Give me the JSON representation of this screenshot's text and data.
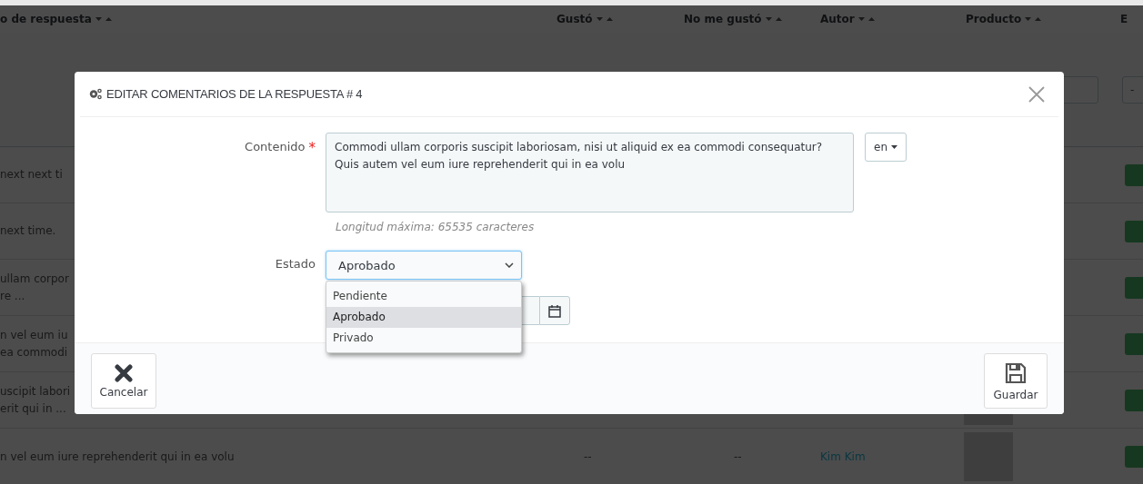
{
  "background_table": {
    "columns": [
      {
        "label": "o de respuesta",
        "sortable": true
      },
      {
        "label": "Gustó",
        "sortable": true
      },
      {
        "label": "No me gustó",
        "sortable": true
      },
      {
        "label": "Autor",
        "sortable": true
      },
      {
        "label": "Producto",
        "sortable": true
      },
      {
        "label": "E",
        "sortable": false
      }
    ],
    "filter_select": "-",
    "rows": [
      {
        "column_1": [
          "next next ti"
        ]
      },
      {
        "column_1": [
          "next time."
        ]
      },
      {
        "column_1": [
          "ullam corpor",
          "re ..."
        ]
      },
      {
        "column_1": [
          "n vel eum iu",
          "ea commodi"
        ]
      },
      {
        "column_1": [
          "uscipit labori",
          "erit qui in ..."
        ],
        "photo": true
      },
      {
        "column_1": [
          "n vel eum iure reprehenderit qui in ea volu"
        ],
        "liked": "--",
        "disliked": "--",
        "author": "Kim Kim",
        "photo": true
      }
    ]
  },
  "modal": {
    "title": "EDITAR COMENTARIOS DE LA RESPUESTA # 4",
    "content_field": {
      "label": "Contenido",
      "required_mark": "*",
      "value": "Commodi ullam corporis suscipit laboriosam, nisi ut aliquid ex ea commodi consequatur? Quis autem vel eum iure reprehenderit qui in ea volu",
      "language": "en",
      "help": "Longitud máxima: 65535 caracteres"
    },
    "status_field": {
      "label": "Estado",
      "value": "Aprobado",
      "expanded": true,
      "options": [
        {
          "label": "Pendiente",
          "selected": false
        },
        {
          "label": "Aprobado",
          "selected": true
        },
        {
          "label": "Privado",
          "selected": false
        }
      ]
    },
    "buttons": [
      {
        "label": "Cancelar",
        "kind": "cancel"
      },
      {
        "label": "Guardar",
        "kind": "save"
      }
    ]
  }
}
